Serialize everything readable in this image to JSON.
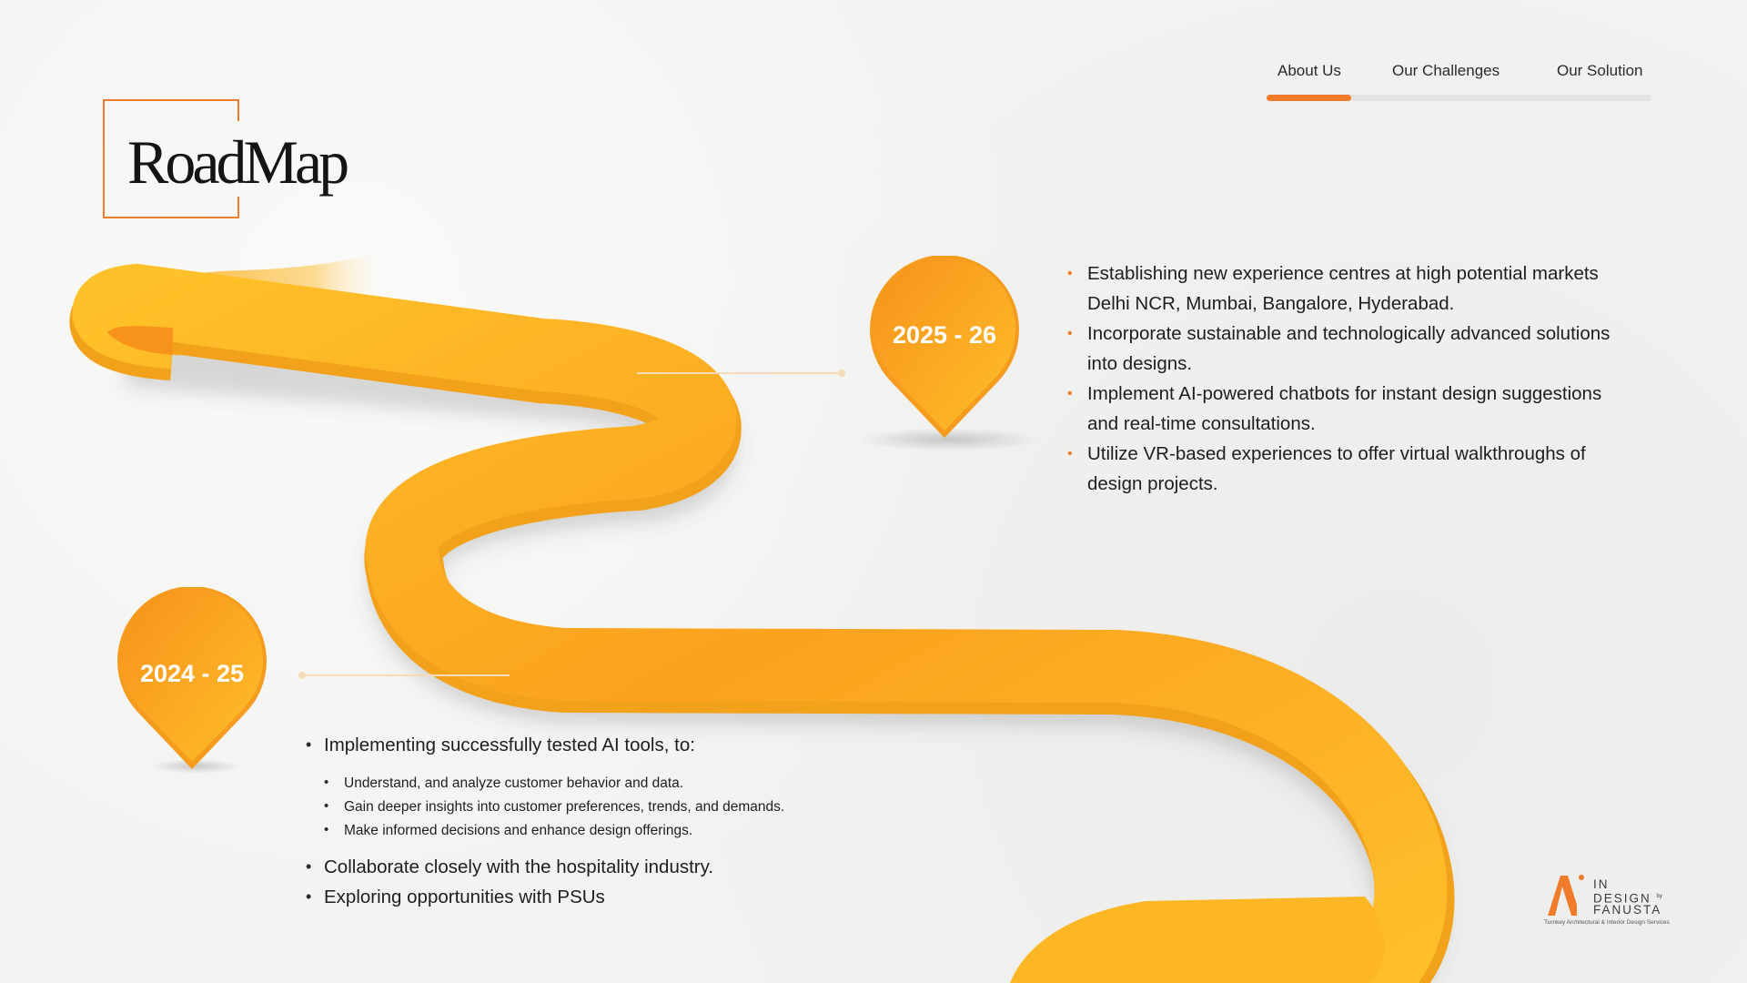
{
  "nav": {
    "items": [
      {
        "label": "About Us",
        "active": true
      },
      {
        "label": "Our Challenges",
        "active": false
      },
      {
        "label": "Our Solution",
        "active": false
      }
    ],
    "accent_color": "#f07b2a"
  },
  "title": "RoadMap",
  "colors": {
    "road_light": "#ffc129",
    "road_dark": "#f7931b",
    "accent": "#f07b2a",
    "connector": "#f6dcb6"
  },
  "milestones": [
    {
      "period": "2025 - 26",
      "bullets": [
        "Establishing new experience centres at high potential markets Delhi NCR, Mumbai, Bangalore, Hyderabad.",
        "Incorporate sustainable and technologically advanced solutions into designs.",
        "Implement AI-powered chatbots for instant design suggestions and real-time consultations.",
        "Utilize VR-based experiences to offer virtual walkthroughs of design projects."
      ]
    },
    {
      "period": "2024 - 25",
      "lead": "Implementing successfully tested AI tools, to:",
      "sub_bullets": [
        "Understand, and analyze customer behavior and data.",
        "Gain deeper insights into customer preferences, trends, and demands.",
        "Make informed decisions and enhance design offerings."
      ],
      "bullets": [
        "Collaborate closely with the hospitality industry.",
        "Exploring opportunities with PSUs"
      ]
    }
  ],
  "logo": {
    "mark": "N",
    "lines": [
      "IN",
      "DESIGN",
      "FANUSTA"
    ],
    "by": "by",
    "tagline": "Turnkey Architectural & Interior Design Services"
  }
}
